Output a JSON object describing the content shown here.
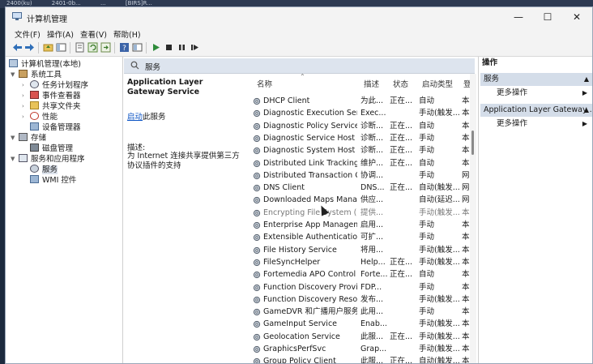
{
  "background_strip": [
    "2400(ku)",
    "2401-0b...",
    "...",
    "[BIRS]R..."
  ],
  "window": {
    "title": "计算机管理",
    "buttons": {
      "minimize": "—",
      "maximize": "☐",
      "close": "✕"
    }
  },
  "menu": [
    "文件(F)",
    "操作(A)",
    "查看(V)",
    "帮助(H)"
  ],
  "toolbar_icons": [
    "back-icon",
    "forward-icon",
    "up-folder-icon",
    "console-tree-icon",
    "properties-icon",
    "refresh-icon",
    "export-icon",
    "help-icon",
    "view-icon",
    "start-service-icon",
    "stop-service-icon",
    "pause-service-icon",
    "restart-service-icon"
  ],
  "tree": {
    "root": "计算机管理(本地)",
    "system_tools": "系统工具",
    "task_scheduler": "任务计划程序",
    "event_viewer": "事件查看器",
    "shared_folders": "共享文件夹",
    "performance": "性能",
    "device_manager": "设备管理器",
    "storage": "存储",
    "disk_management": "磁盘管理",
    "services_apps": "服务和应用程序",
    "services": "服务",
    "wmi": "WMI 控件"
  },
  "center": {
    "header": "服务",
    "selected_service": "Application Layer Gateway Service",
    "start_link": "启动",
    "start_suffix": "此服务",
    "desc_label": "描述:",
    "desc_text": "为 Internet 连接共享提供第三方协议插件的支持"
  },
  "columns": {
    "name": "名称",
    "desc": "描述",
    "status": "状态",
    "startup": "启动类型",
    "logon": "登"
  },
  "services": [
    {
      "name": "DHCP Client",
      "desc": "为此...",
      "status": "正在...",
      "startup": "自动",
      "logon": "本"
    },
    {
      "name": "Diagnostic Execution Service",
      "desc": "Exec...",
      "status": "",
      "startup": "手动(触发...",
      "logon": "本"
    },
    {
      "name": "Diagnostic Policy Service",
      "desc": "诊断...",
      "status": "正在...",
      "startup": "自动",
      "logon": "本"
    },
    {
      "name": "Diagnostic Service Host",
      "desc": "诊断...",
      "status": "正在...",
      "startup": "手动",
      "logon": "本"
    },
    {
      "name": "Diagnostic System Host",
      "desc": "诊断...",
      "status": "正在...",
      "startup": "手动",
      "logon": "本"
    },
    {
      "name": "Distributed Link Tracking C...",
      "desc": "维护...",
      "status": "正在...",
      "startup": "自动",
      "logon": "本"
    },
    {
      "name": "Distributed Transaction Co...",
      "desc": "协调...",
      "status": "",
      "startup": "手动",
      "logon": "网"
    },
    {
      "name": "DNS Client",
      "desc": "DNS...",
      "status": "正在...",
      "startup": "自动(触发...",
      "logon": "网"
    },
    {
      "name": "Downloaded Maps Manager",
      "desc": "供应...",
      "status": "",
      "startup": "自动(延迟...",
      "logon": "网"
    },
    {
      "name": "Encrypting File System (EFS)",
      "desc": "提供...",
      "status": "",
      "startup": "手动(触发...",
      "logon": "本"
    },
    {
      "name": "Enterprise App Manageme...",
      "desc": "启用...",
      "status": "",
      "startup": "手动",
      "logon": "本"
    },
    {
      "name": "Extensible Authentication ...",
      "desc": "可扩...",
      "status": "",
      "startup": "手动",
      "logon": "本"
    },
    {
      "name": "File History Service",
      "desc": "将用...",
      "status": "",
      "startup": "手动(触发...",
      "logon": "本"
    },
    {
      "name": "FileSyncHelper",
      "desc": "Help...",
      "status": "正在...",
      "startup": "手动(触发...",
      "logon": "本"
    },
    {
      "name": "Fortemedia APO Control S...",
      "desc": "Forte...",
      "status": "正在...",
      "startup": "自动",
      "logon": "本"
    },
    {
      "name": "Function Discovery Provide...",
      "desc": "FDP...",
      "status": "",
      "startup": "手动",
      "logon": "本"
    },
    {
      "name": "Function Discovery Resour...",
      "desc": "发布...",
      "status": "",
      "startup": "手动(触发...",
      "logon": "本"
    },
    {
      "name": "GameDVR 和广播用户服务...",
      "desc": "此用...",
      "status": "",
      "startup": "手动",
      "logon": "本"
    },
    {
      "name": "GameInput Service",
      "desc": "Enab...",
      "status": "",
      "startup": "手动(触发...",
      "logon": "本"
    },
    {
      "name": "Geolocation Service",
      "desc": "此服...",
      "status": "正在...",
      "startup": "手动(触发...",
      "logon": "本"
    },
    {
      "name": "GraphicsPerfSvc",
      "desc": "Grap...",
      "status": "",
      "startup": "手动(触发...",
      "logon": "本"
    },
    {
      "name": "Group Policy Client",
      "desc": "此服...",
      "status": "正在...",
      "startup": "自动(触发...",
      "logon": "本"
    }
  ],
  "actions": {
    "header": "操作",
    "section1": "服务",
    "more1": "更多操作",
    "section2": "Application Layer Gateway ...",
    "more2": "更多操作"
  },
  "colors": {
    "selection": "#d4dde9",
    "link": "#0b53c4",
    "header_bg": "#dde4ee"
  }
}
